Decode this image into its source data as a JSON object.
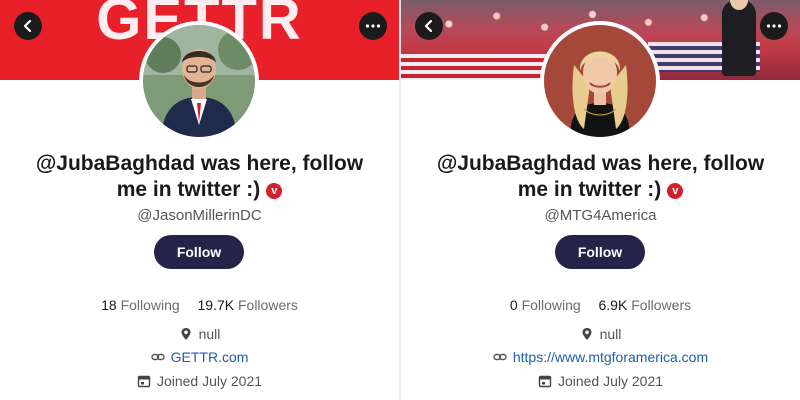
{
  "left": {
    "banner_logo": "GETTR",
    "name_line1": "@JubaBaghdad was here, follow",
    "name_line2": "me in twitter :)",
    "verified_mark": "v",
    "handle": "@JasonMillerinDC",
    "follow_label": "Follow",
    "following_count": "18",
    "following_label": "Following",
    "followers_count": "19.7K",
    "followers_label": "Followers",
    "location": "null",
    "website": "GETTR.com",
    "joined": "Joined July 2021"
  },
  "right": {
    "name_line1": "@JubaBaghdad was here, follow",
    "name_line2": "me in twitter :)",
    "verified_mark": "v",
    "handle": "@MTG4America",
    "follow_label": "Follow",
    "following_count": "0",
    "following_label": "Following",
    "followers_count": "6.9K",
    "followers_label": "Followers",
    "location": "null",
    "website": "https://www.mtgforamerica.com",
    "joined": "Joined July 2021"
  },
  "colors": {
    "brand_red": "#e8202a",
    "follow_button": "#24244a",
    "link": "#1f5ea8",
    "verified": "#d71f2b"
  },
  "icons": {
    "back": "chevron-left-icon",
    "more": "more-dots-icon",
    "location": "location-pin-icon",
    "website": "link-icon",
    "joined": "calendar-icon"
  }
}
